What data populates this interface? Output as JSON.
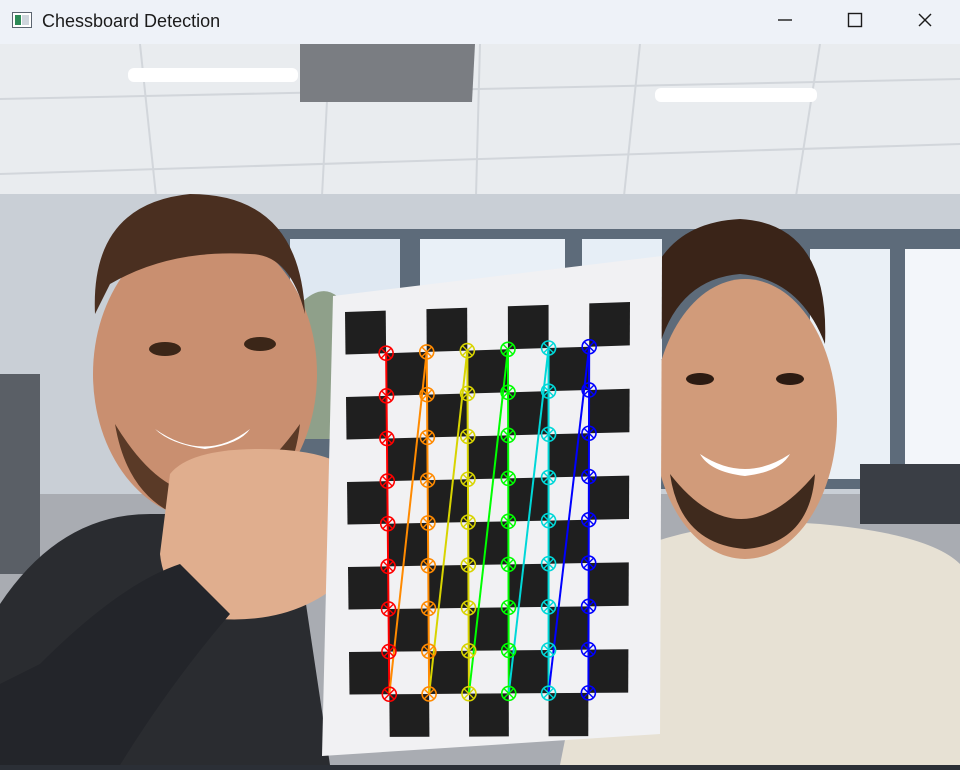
{
  "window": {
    "title": "Chessboard Detection",
    "icons": {
      "app": "image-window-icon",
      "minimize": "minimize-icon",
      "maximize": "maximize-icon",
      "close": "close-icon"
    }
  },
  "detection": {
    "pattern_columns": 6,
    "pattern_rows": 9,
    "series_colors": [
      "#ff0000",
      "#ff8a00",
      "#d8d400",
      "#00ff00",
      "#00d8d8",
      "#0000ff"
    ]
  },
  "colors": {
    "titlebar": "#eef2f8",
    "chessboard_square": "#1f1f1f",
    "paper": "#f1f1f3"
  }
}
